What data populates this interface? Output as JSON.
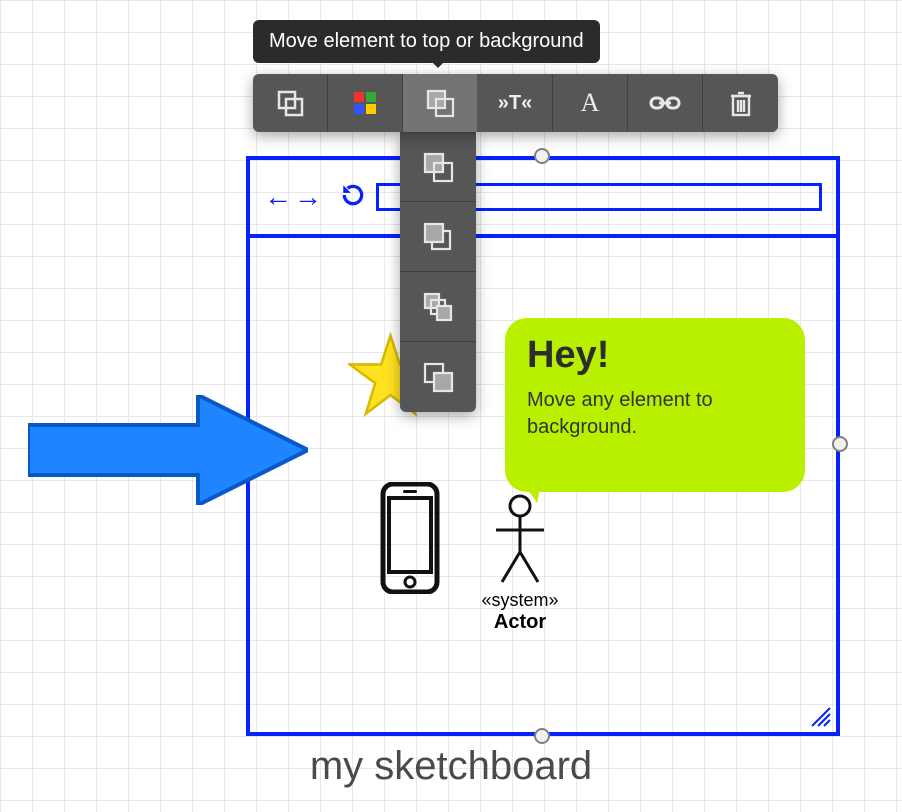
{
  "tooltip": {
    "text": "Move element to top or background"
  },
  "toolbar": {
    "items": [
      {
        "name": "group",
        "hint": "Group"
      },
      {
        "name": "palette",
        "hint": "Color palette"
      },
      {
        "name": "layer",
        "hint": "Move to top / background"
      },
      {
        "name": "tag",
        "hint": "Insert type",
        "label": "»T«"
      },
      {
        "name": "text",
        "hint": "Text",
        "label": "A"
      },
      {
        "name": "link",
        "hint": "Link"
      },
      {
        "name": "delete",
        "hint": "Delete"
      }
    ]
  },
  "layer_menu": {
    "items": [
      {
        "name": "bring-to-front"
      },
      {
        "name": "bring-forward"
      },
      {
        "name": "send-backward"
      },
      {
        "name": "send-to-back"
      }
    ]
  },
  "bubble": {
    "heading": "Hey!",
    "body": "Move any element to background."
  },
  "actor": {
    "stereotype": "«system»",
    "name": "Actor"
  },
  "board": {
    "title": "my sketchboard"
  }
}
